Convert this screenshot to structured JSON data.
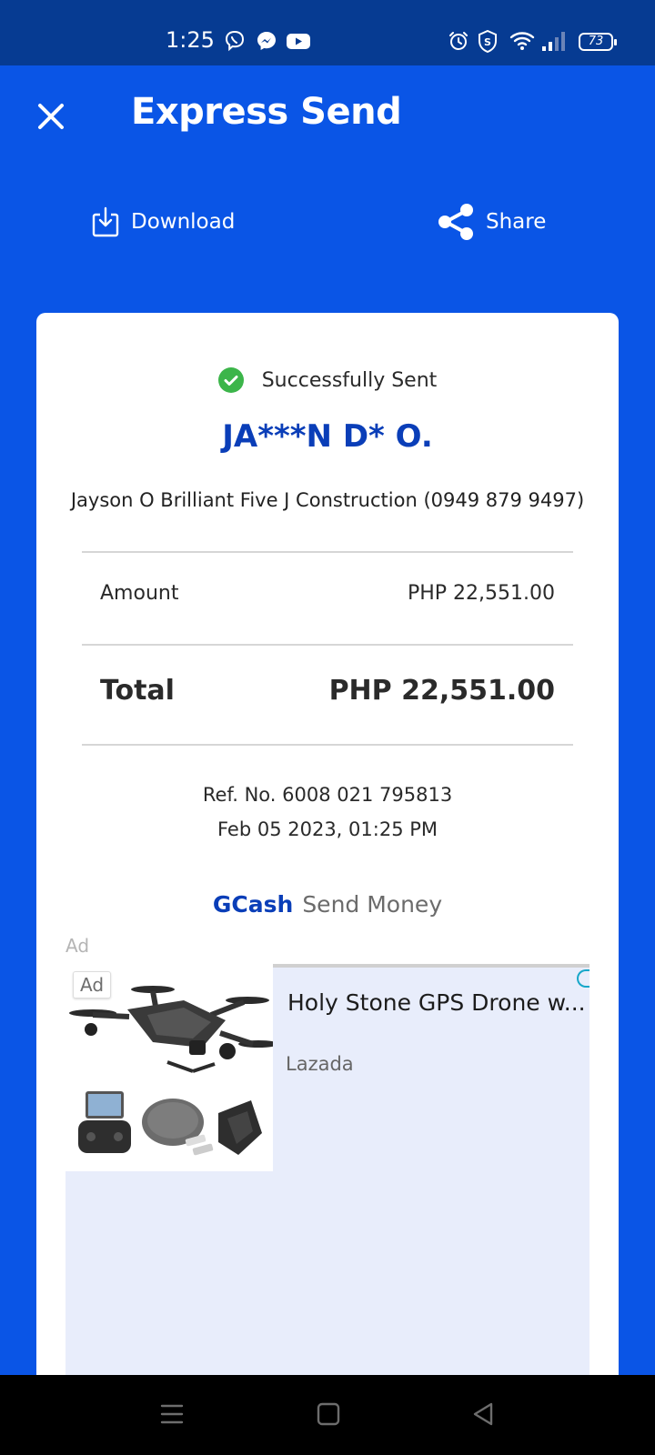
{
  "status_bar": {
    "time": "1:25",
    "left_icons": [
      "viber-icon",
      "messenger-icon",
      "youtube-icon"
    ],
    "right_icons": [
      "alarm-icon",
      "shield-icon",
      "wifi-icon",
      "signal-icon"
    ],
    "battery": "73"
  },
  "header": {
    "title": "Express Send",
    "close_icon": "close-icon",
    "download_label": "Download",
    "share_label": "Share"
  },
  "receipt": {
    "status": "Successfully Sent",
    "recipient_name": "JA***N D* O.",
    "recipient_detail": "Jayson O Brilliant Five J Construction (0949 879 9497)",
    "amount_label": "Amount",
    "amount_value": "PHP 22,551.00",
    "total_label": "Total",
    "total_value": "PHP 22,551.00",
    "ref_no": "Ref. No. 6008 021 795813",
    "datetime": "Feb 05 2023, 01:25 PM",
    "brand": "GCash",
    "service": "Send Money"
  },
  "ad": {
    "label": "Ad",
    "badge": "Ad",
    "title": "Holy Stone GPS Drone w...",
    "source": "Lazada"
  },
  "colors": {
    "primary_blue": "#0a55e6",
    "status_bar_blue": "#063b92",
    "brand_blue": "#0a3eb8",
    "success_green": "#3cb54a"
  },
  "nav_bar": {
    "buttons": [
      "menu-icon",
      "home-icon",
      "back-icon"
    ]
  }
}
